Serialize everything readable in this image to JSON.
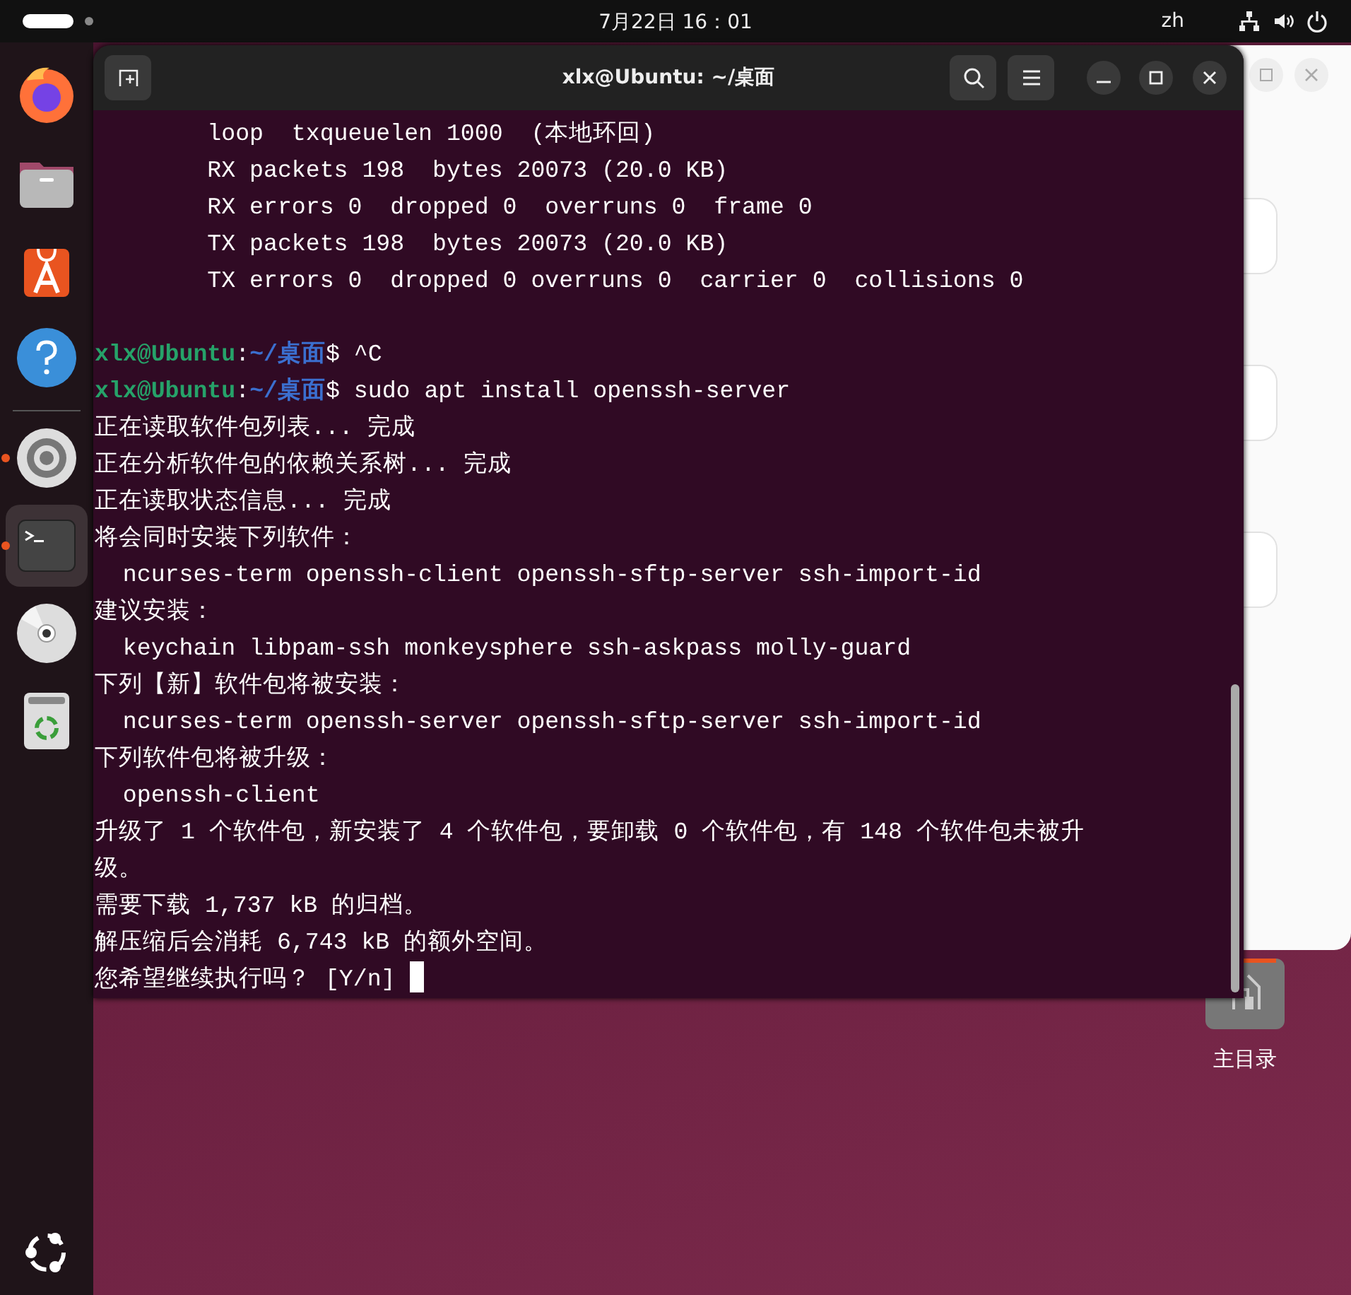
{
  "top_bar": {
    "date_time": "7月22日 16：01",
    "input_method": "zh"
  },
  "dock": {
    "items": [
      {
        "kind": "firefox",
        "running": false,
        "selected": false
      },
      {
        "kind": "files",
        "running": false,
        "selected": false
      },
      {
        "kind": "software",
        "running": false,
        "selected": false
      },
      {
        "kind": "help",
        "running": false,
        "selected": false
      },
      {
        "kind": "settings",
        "running": true,
        "selected": false
      },
      {
        "kind": "terminal",
        "running": true,
        "selected": true
      },
      {
        "kind": "disc",
        "running": false,
        "selected": false
      },
      {
        "kind": "trash",
        "running": false,
        "selected": false
      }
    ]
  },
  "terminal": {
    "title": "xlx@Ubuntu: ~/桌面",
    "lines": [
      {
        "kind": "output",
        "text": "        loop  txqueuelen 1000  (本地环回)"
      },
      {
        "kind": "output",
        "text": "        RX packets 198  bytes 20073 (20.0 KB)"
      },
      {
        "kind": "output",
        "text": "        RX errors 0  dropped 0  overruns 0  frame 0"
      },
      {
        "kind": "output",
        "text": "        TX packets 198  bytes 20073 (20.0 KB)"
      },
      {
        "kind": "output",
        "text": "        TX errors 0  dropped 0 overruns 0  carrier 0  collisions 0"
      },
      {
        "kind": "blank"
      },
      {
        "kind": "prompt",
        "user": "xlx@Ubuntu",
        "separator": ":",
        "path": "~/桌面",
        "command": "$ ^C"
      },
      {
        "kind": "prompt",
        "user": "xlx@Ubuntu",
        "separator": ":",
        "path": "~/桌面",
        "command": "$ sudo apt install openssh-server"
      },
      {
        "kind": "output",
        "text": "正在读取软件包列表... 完成"
      },
      {
        "kind": "output",
        "text": "正在分析软件包的依赖关系树... 完成"
      },
      {
        "kind": "output",
        "text": "正在读取状态信息... 完成"
      },
      {
        "kind": "output",
        "text": "将会同时安装下列软件："
      },
      {
        "kind": "output",
        "text": "  ncurses-term openssh-client openssh-sftp-server ssh-import-id"
      },
      {
        "kind": "output",
        "text": "建议安装："
      },
      {
        "kind": "output",
        "text": "  keychain libpam-ssh monkeysphere ssh-askpass molly-guard"
      },
      {
        "kind": "output",
        "text": "下列【新】软件包将被安装："
      },
      {
        "kind": "output",
        "text": "  ncurses-term openssh-server openssh-sftp-server ssh-import-id"
      },
      {
        "kind": "output",
        "text": "下列软件包将被升级："
      },
      {
        "kind": "output",
        "text": "  openssh-client"
      },
      {
        "kind": "output",
        "text": "升级了 1 个软件包，新安装了 4 个软件包，要卸载 0 个软件包，有 148 个软件包未被升"
      },
      {
        "kind": "output",
        "text": "级。"
      },
      {
        "kind": "output",
        "text": "需要下载 1,737 kB 的归档。"
      },
      {
        "kind": "output",
        "text": "解压缩后会消耗 6,743 kB 的额外空间。"
      },
      {
        "kind": "input",
        "text": "您希望继续执行吗？ [Y/n] "
      }
    ]
  },
  "desktop_icons": [
    {
      "label": "主目录"
    }
  ]
}
